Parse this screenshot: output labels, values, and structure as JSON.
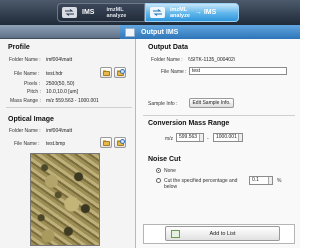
{
  "topbar": {
    "left_mode": {
      "main": "IMS",
      "line1": "imzML",
      "line2": "analyze"
    },
    "right_mode": {
      "line1": "imzML",
      "line2": "analyze",
      "main": "IMS"
    }
  },
  "tab": {
    "label": "Output IMS"
  },
  "profile": {
    "heading": "Profile",
    "folder_label": "Folder Name :",
    "folder_value": "imf004\\matt",
    "file_label": "File Name :",
    "file_value": "test.hdr",
    "pixels_label": "Pixels :",
    "pixels_value": "2500(50, 50)",
    "pitch_label": "Pitch :",
    "pitch_value": "10.0,10.0 [um]",
    "mass_label": "Mass Range :",
    "mass_value": "m/z 559.563 - 1000.001"
  },
  "optical": {
    "heading": "Optical Image",
    "folder_label": "Folder Name :",
    "folder_value": "imf004\\matt",
    "file_label": "File Name :",
    "file_value": "test.bmp"
  },
  "output": {
    "heading": "Output Data",
    "folder_label": "Folder Name :",
    "folder_value": "\\\\SITK-1135_000402\\",
    "file_label": "File Name :",
    "file_value": "test",
    "sample_info_label": "Sample Info :",
    "edit_button": "Edit Sample Info."
  },
  "conversion": {
    "heading": "Conversion Mass Range",
    "unit": "m/z",
    "from_value": "599.563",
    "separator": "-",
    "to_value": "1000.001"
  },
  "noise": {
    "heading": "Noise Cut",
    "option_none": "None",
    "option_cut": "Cut the specified percentage and below",
    "percent_value": "0.1",
    "percent_unit": "%"
  },
  "footer": {
    "add_button": "Add to List"
  }
}
